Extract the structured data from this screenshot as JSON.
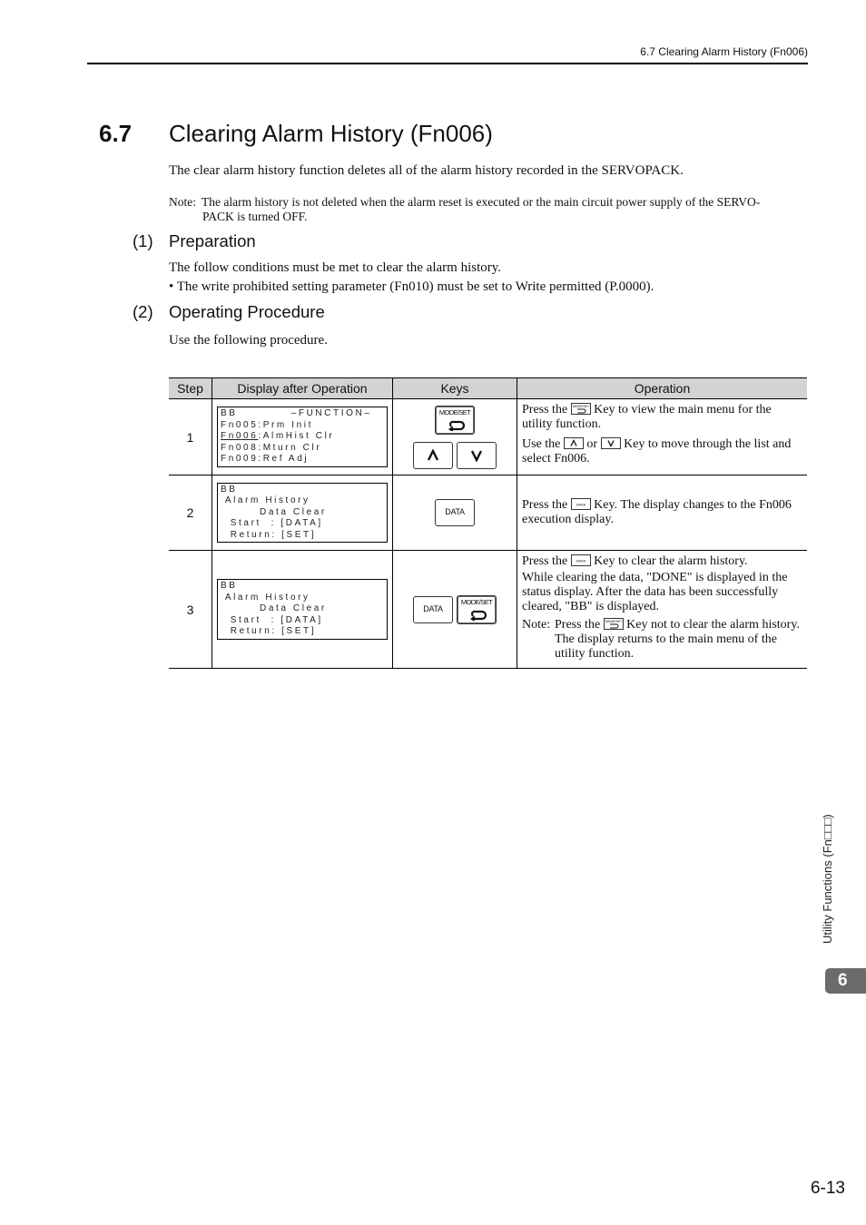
{
  "running_header": "6.7  Clearing Alarm History (Fn006)",
  "section": {
    "number": "6.7",
    "title": "Clearing Alarm History (Fn006)",
    "intro": "The clear alarm history function deletes all of the alarm history recorded in the SERVOPACK.",
    "note_label": "Note:",
    "note_line1": "The alarm history is not deleted when the alarm reset is executed or the main circuit power supply of the SERVO-",
    "note_line2": "PACK is turned OFF."
  },
  "preparation": {
    "number": "(1)",
    "heading": "Preparation",
    "text": "The follow conditions must be met to clear the alarm history.",
    "bullet": "• The write prohibited setting parameter (Fn010) must be set to Write permitted (P.0000)."
  },
  "procedure": {
    "number": "(2)",
    "heading": "Operating Procedure",
    "text": "Use the following procedure."
  },
  "table": {
    "headers": [
      "Step",
      "Display after Operation",
      "Keys",
      "Operation"
    ],
    "rows": [
      {
        "step": "1",
        "display": {
          "l1a": "BB",
          "l1b": "–FUNCTION–",
          "l2": "Fn005:Prm Init",
          "l3a": "Fn006",
          "l3b": ":AlmHist Clr",
          "l4": "Fn008:Mturn Clr",
          "l5": "Fn009:Ref Adj"
        },
        "keys": [
          "MODE/SET",
          "UP",
          "DOWN"
        ],
        "op": {
          "p1a": "Press the",
          "p1b": "Key to view the main menu for the utility function.",
          "p2a": "Use the",
          "p2b": "or",
          "p2c": "Key to move through the list and select Fn006."
        }
      },
      {
        "step": "2",
        "display": {
          "l1": "BB",
          "l2": " Alarm History",
          "l3": "        Data Clear",
          "l4": "  Start  : [DATA]",
          "l5": "  Return: [SET]"
        },
        "keys": [
          "DATA"
        ],
        "op": {
          "p1a": "Press the",
          "p1b": "Key. The display changes to the Fn006 execution display."
        }
      },
      {
        "step": "3",
        "display": {
          "l1": "BB",
          "l2": " Alarm History",
          "l3": "        Data Clear",
          "l4": "  Start  : [DATA]",
          "l5": "  Return: [SET]"
        },
        "keys": [
          "DATA",
          "MODE/SET"
        ],
        "op": {
          "p1a": "Press the",
          "p1b": "Key to clear the alarm history.",
          "p2": "While clearing the data, \"DONE\" is displayed in the status display. After the data has been successfully cleared, \"BB\" is displayed.",
          "note_label": "Note:",
          "note_a": "Press the",
          "note_b": "Key not to clear the alarm history. The display returns to the main menu of the utility function."
        }
      }
    ],
    "key_labels": {
      "mode_set": "MODE/SET",
      "data": "DATA"
    }
  },
  "side_tab": {
    "label": "Utility Functions (Fn□□□)",
    "chapter": "6"
  },
  "page_number": "6-13"
}
